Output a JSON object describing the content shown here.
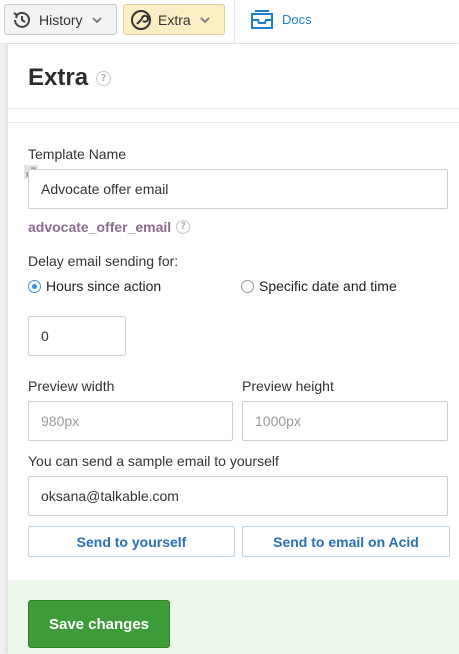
{
  "toolbar": {
    "history_label": "History",
    "extra_label": "Extra",
    "docs_label": "Docs"
  },
  "panel": {
    "title": "Extra",
    "help_glyph": "?",
    "template_name_label": "Template Name",
    "template_name_value": "Advocate offer email",
    "slug": "advocate_offer_email",
    "delay_label": "Delay email sending for:",
    "radio_hours_label": "Hours since action",
    "radio_specific_label": "Specific date and time",
    "radio_selected": "hours",
    "hours_value": "0",
    "preview_width_label": "Preview width",
    "preview_width_placeholder": "980px",
    "preview_height_label": "Preview height",
    "preview_height_placeholder": "1000px",
    "sample_label": "You can send a sample email to yourself",
    "sample_email_value": "oksana@talkable.com",
    "send_yourself_label": "Send to yourself",
    "send_acid_label": "Send to email on Acid",
    "save_label": "Save changes"
  },
  "icons": {
    "history": "clock-icon",
    "extra": "wrench-icon",
    "docs": "inbox-icon",
    "resize": "expand-icon",
    "chevron": "chevron-down-icon"
  },
  "colors": {
    "accent_blue": "#1a7fd1",
    "save_green": "#3e9b3a",
    "extra_bg": "#fbeec4",
    "slug_color": "#8a6d8e"
  }
}
